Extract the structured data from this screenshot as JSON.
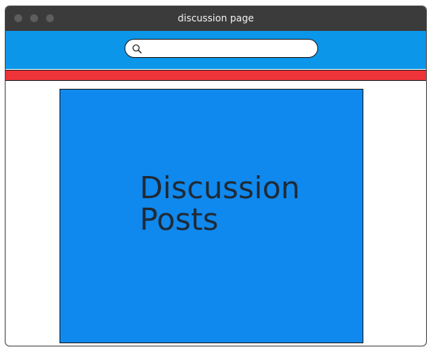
{
  "window": {
    "title": "discussion page"
  },
  "search": {
    "value": "",
    "placeholder": ""
  },
  "main": {
    "heading": "Discussion Posts"
  },
  "colors": {
    "titlebar": "#3b3b3b",
    "search_area": "#0b96ea",
    "red_bar": "#ee3339",
    "content_panel": "#1089ee"
  }
}
